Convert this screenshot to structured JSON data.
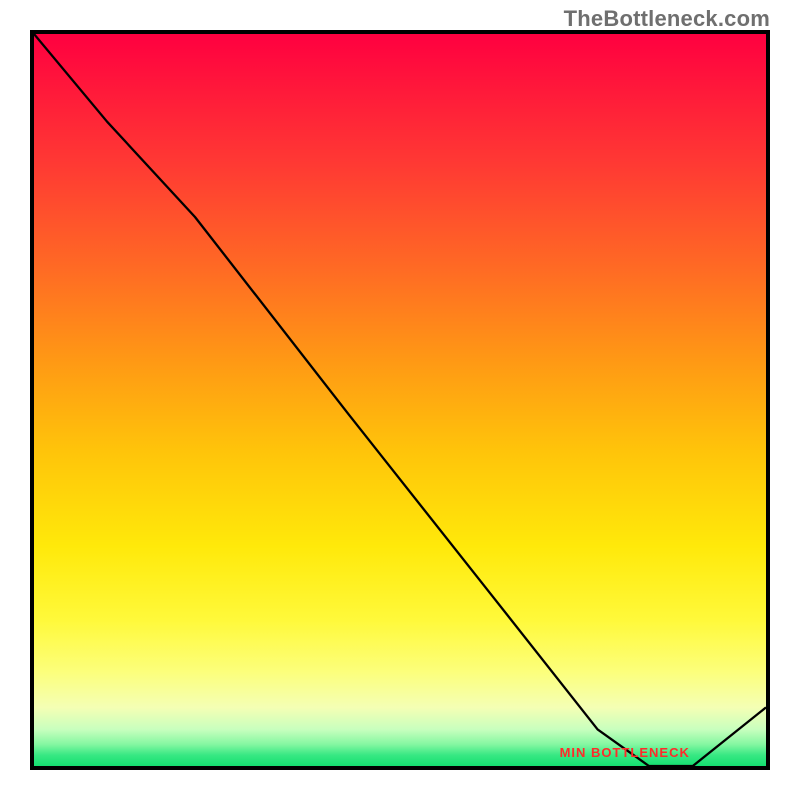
{
  "watermark": "TheBottleneck.com",
  "chart_data": {
    "type": "line",
    "x": [
      0.0,
      0.1,
      0.22,
      0.43,
      0.62,
      0.77,
      0.84,
      0.9,
      1.0
    ],
    "values": [
      1.0,
      0.88,
      0.75,
      0.48,
      0.24,
      0.05,
      0.0,
      0.0,
      0.08
    ],
    "title": "",
    "xlabel": "",
    "ylabel": "",
    "xlim": [
      0,
      1
    ],
    "ylim": [
      0,
      1
    ],
    "annotations": [
      {
        "text": "MIN BOTTLENECK",
        "x": 0.8,
        "y": 0.01
      }
    ],
    "background": "red-yellow-green vertical gradient (bottleneck heatmap)"
  }
}
